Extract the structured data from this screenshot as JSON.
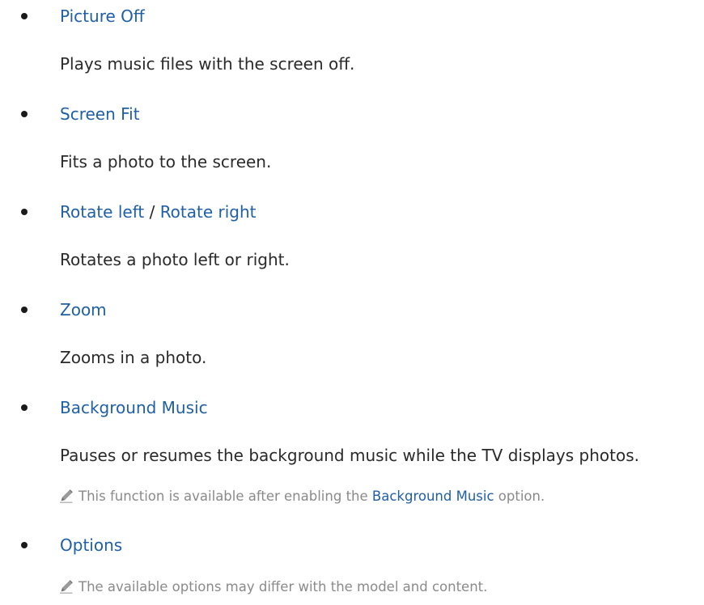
{
  "items": [
    {
      "term": "Picture Off",
      "description": "Plays music files with the screen off."
    },
    {
      "term": "Screen Fit",
      "description": "Fits a photo to the screen."
    },
    {
      "term_left": "Rotate left",
      "term_separator": " / ",
      "term_right": "Rotate right",
      "description": "Rotates a photo left or right."
    },
    {
      "term": "Zoom",
      "description": "Zooms in a photo."
    },
    {
      "term": "Background Music",
      "description": "Pauses or resumes the background music while the TV displays photos.",
      "note": {
        "before": "This function is available after enabling the ",
        "highlight": "Background Music",
        "after": " option."
      }
    },
    {
      "term": "Options",
      "note": {
        "text": "The available options may differ with the model and content."
      }
    }
  ],
  "colors": {
    "term": "#1f5fa6",
    "body_text": "#2a2a2a",
    "note_text": "#8a8a8a",
    "bullet": "#1a1a1a"
  },
  "icons": [
    "pencil-note-icon"
  ]
}
